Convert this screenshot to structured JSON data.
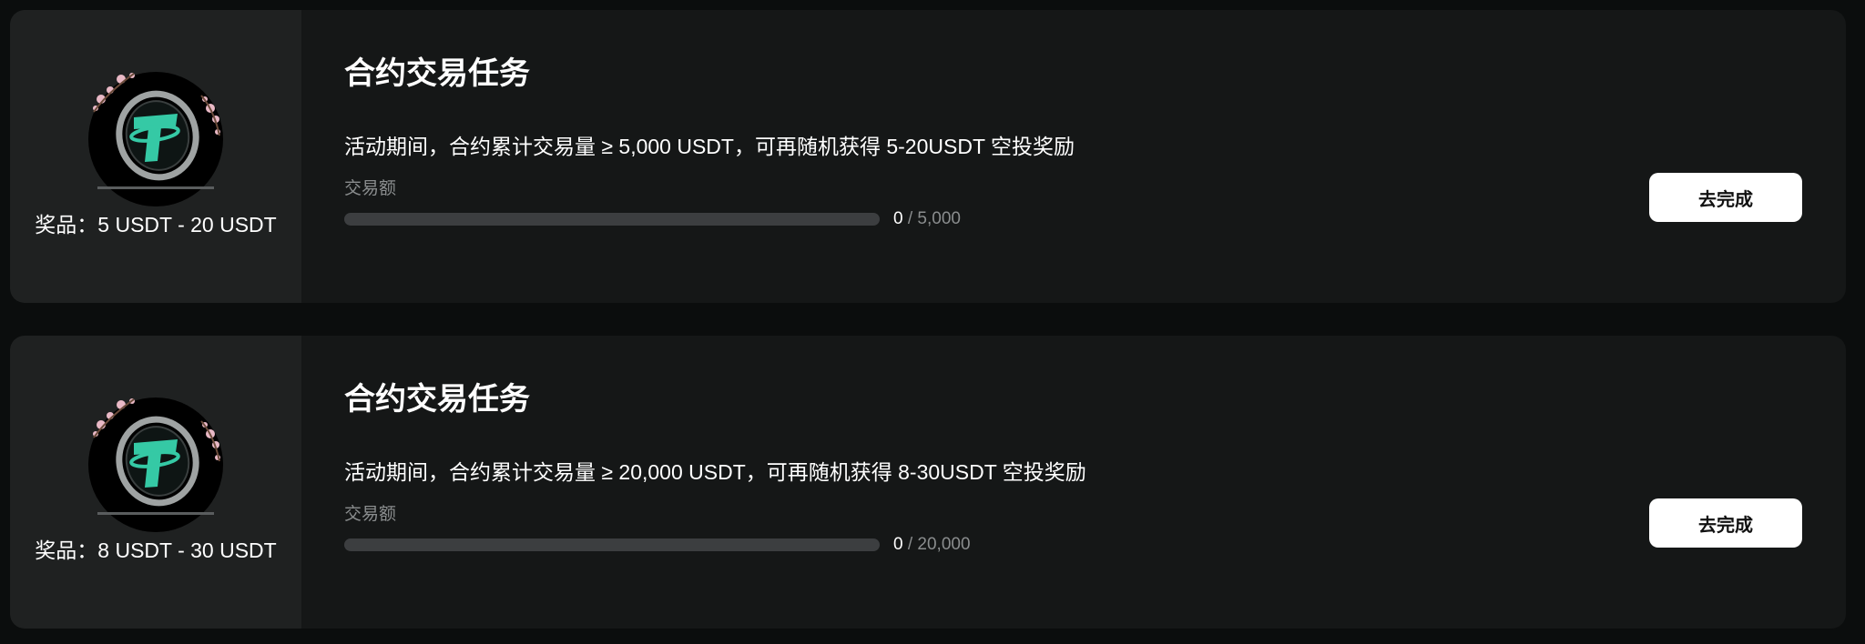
{
  "colors": {
    "page_background": "#0b0d0d",
    "card_background": "#151717",
    "prize_panel_background": "#1f2121",
    "progress_track": "#3c3e40",
    "muted_text": "#8a8d8e",
    "tether_green": "#35c9a5",
    "button_background": "#ffffff"
  },
  "tasks": [
    {
      "icon": "tether-coin-icon",
      "prize": "奖品：5 USDT - 20 USDT",
      "title": "合约交易任务",
      "description": "活动期间，合约累计交易量 ≥ 5,000 USDT，可再随机获得 5-20USDT 空投奖励",
      "metric_label": "交易额",
      "progress_current": "0",
      "progress_separator": "/",
      "progress_target": "5,000",
      "progress_fraction": 0,
      "button_label": "去完成"
    },
    {
      "icon": "tether-coin-icon",
      "prize": "奖品：8 USDT - 30 USDT",
      "title": "合约交易任务",
      "description": "活动期间，合约累计交易量 ≥ 20,000 USDT，可再随机获得 8-30USDT 空投奖励",
      "metric_label": "交易额",
      "progress_current": "0",
      "progress_separator": "/",
      "progress_target": "20,000",
      "progress_fraction": 0,
      "button_label": "去完成"
    }
  ]
}
